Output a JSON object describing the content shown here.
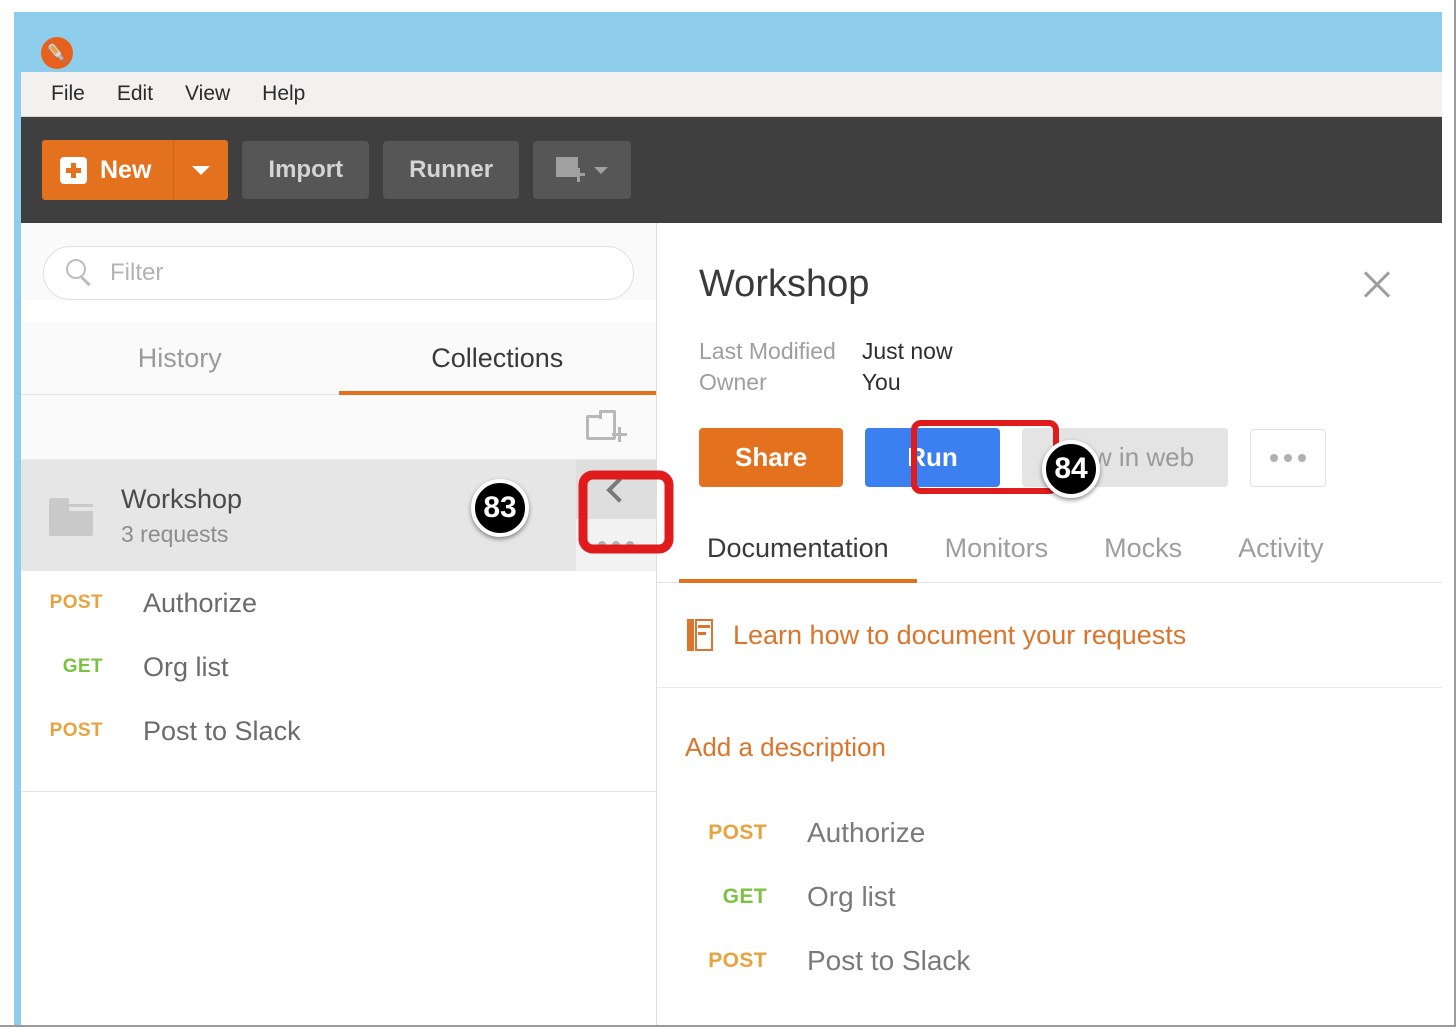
{
  "app": {
    "logo_icon": "postman-logo-icon",
    "title_bar_color": "#8ecdec"
  },
  "menubar": {
    "items": [
      {
        "label": "File"
      },
      {
        "label": "Edit"
      },
      {
        "label": "View"
      },
      {
        "label": "Help"
      }
    ]
  },
  "toolbar": {
    "new_label": "New",
    "new_icon": "plus-square-icon",
    "new_dropdown_icon": "caret-down-icon",
    "import_label": "Import",
    "runner_label": "Runner",
    "new_environment_icon": "new-window-icon",
    "accent_color": "#e3711e",
    "background_color": "#3f3f3f"
  },
  "sidebar": {
    "filter": {
      "placeholder": "Filter",
      "value": "",
      "icon": "search-icon"
    },
    "tabs": [
      {
        "label": "History",
        "active": false
      },
      {
        "label": "Collections",
        "active": true
      }
    ],
    "new_folder_icon": "new-folder-icon",
    "collection": {
      "folder_icon": "folder-icon",
      "name": "Workshop",
      "count": "3 requests",
      "collapse_icon": "chevron-left-icon",
      "more_icon": "ellipsis-icon"
    },
    "requests": [
      {
        "method": "POST",
        "method_class": "post",
        "name": "Authorize"
      },
      {
        "method": "GET",
        "method_class": "get",
        "name": "Org list"
      },
      {
        "method": "POST",
        "method_class": "post",
        "name": "Post to Slack"
      }
    ]
  },
  "detail": {
    "title": "Workshop",
    "close_icon": "close-icon",
    "meta": [
      {
        "label": "Last Modified",
        "value": "Just now"
      },
      {
        "label": "Owner",
        "value": "You"
      }
    ],
    "actions": {
      "share_label": "Share",
      "run_label": "Run",
      "view_web_label": "View in web",
      "more_icon": "ellipsis-icon"
    },
    "tabs": [
      {
        "label": "Documentation",
        "active": true
      },
      {
        "label": "Monitors",
        "active": false
      },
      {
        "label": "Mocks",
        "active": false
      },
      {
        "label": "Activity",
        "active": false
      }
    ],
    "documentation": {
      "learn_icon": "book-icon",
      "learn_label": "Learn how to document your requests",
      "add_description_label": "Add a description",
      "requests": [
        {
          "method": "POST",
          "method_class": "post",
          "name": "Authorize"
        },
        {
          "method": "GET",
          "method_class": "get",
          "name": "Org list"
        },
        {
          "method": "POST",
          "method_class": "post",
          "name": "Post to Slack"
        }
      ]
    }
  },
  "annotations": {
    "badges": [
      {
        "number": "83",
        "target": "sidebar-collapse-button"
      },
      {
        "number": "84",
        "target": "view-in-web-button"
      }
    ],
    "highlight_color": "#e01b1b",
    "highlights": [
      {
        "target": "sidebar-collapse-button"
      },
      {
        "target": "run-button"
      }
    ]
  }
}
